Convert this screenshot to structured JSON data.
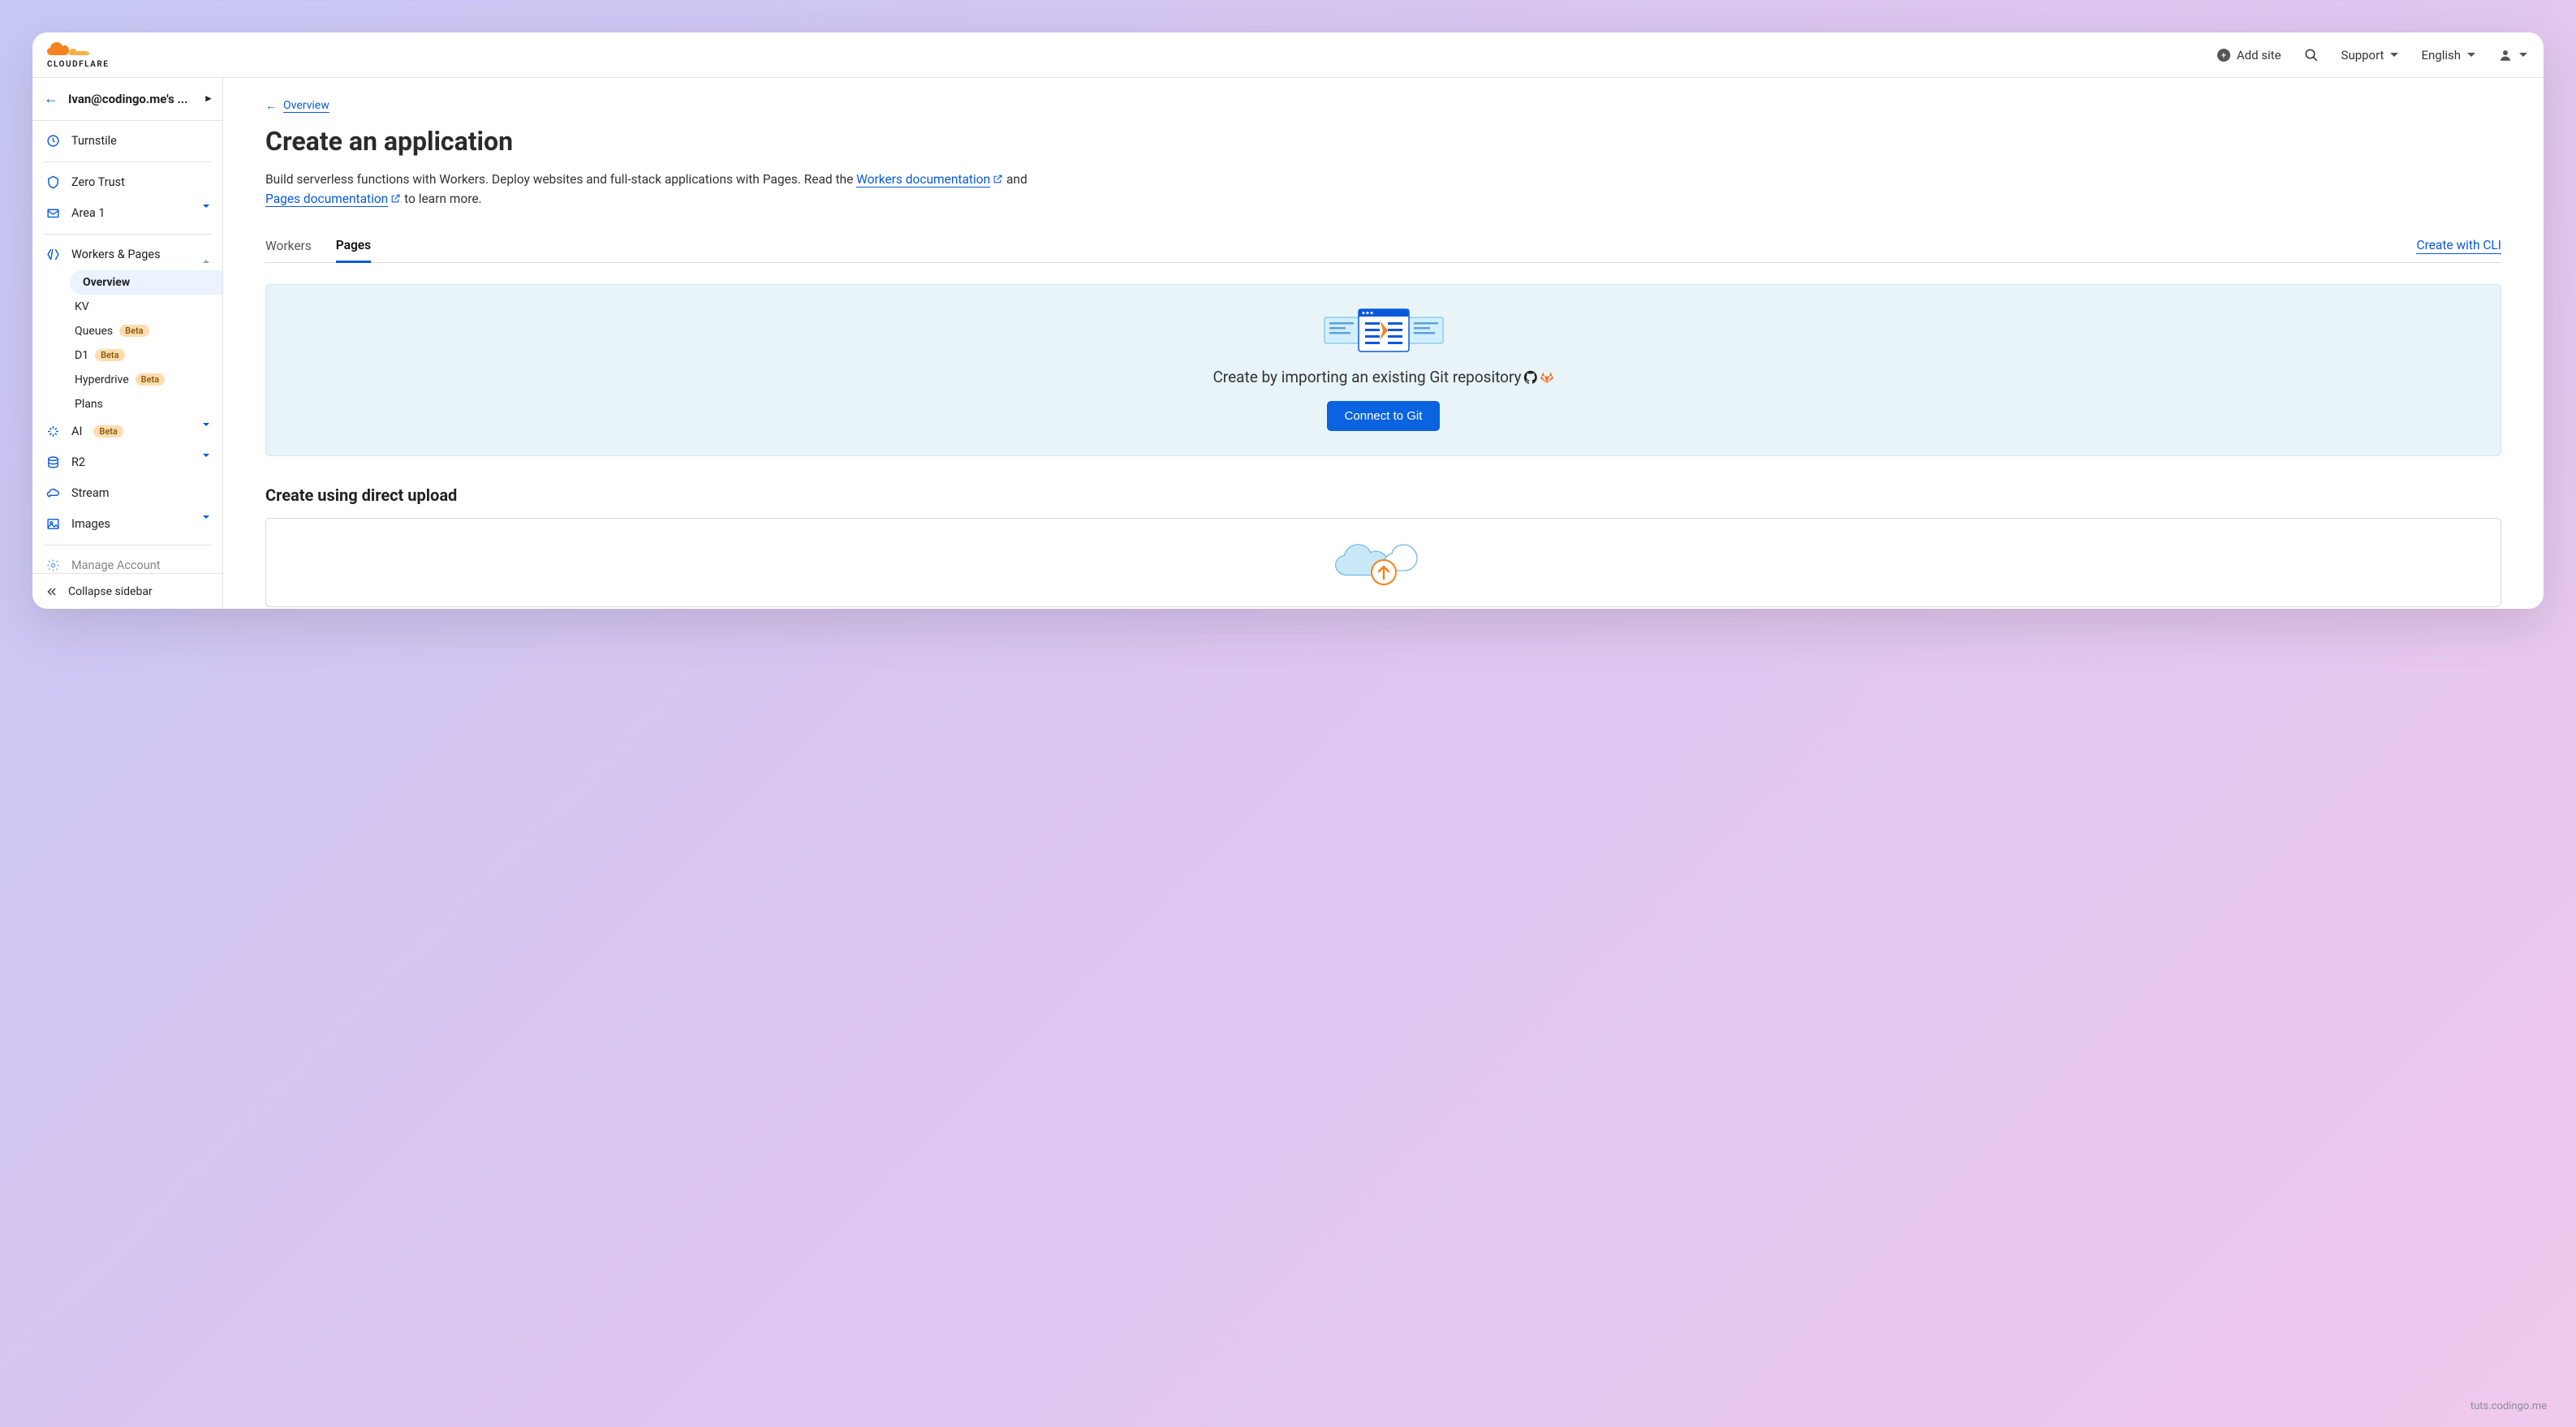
{
  "brand": "CLOUDFLARE",
  "header": {
    "add_site": "Add site",
    "support": "Support",
    "language": "English"
  },
  "account": {
    "name": "Ivan@codingo.me's ..."
  },
  "sidebar": {
    "turnstile": "Turnstile",
    "zero_trust": "Zero Trust",
    "area1": "Area 1",
    "workers_pages": "Workers & Pages",
    "sub": {
      "overview": "Overview",
      "kv": "KV",
      "queues": "Queues",
      "d1": "D1",
      "hyperdrive": "Hyperdrive",
      "plans": "Plans"
    },
    "ai": "AI",
    "r2": "R2",
    "stream": "Stream",
    "images": "Images",
    "manage_account": "Manage Account",
    "beta": "Beta",
    "collapse": "Collapse sidebar"
  },
  "main": {
    "back": "Overview",
    "title": "Create an application",
    "desc_1": "Build serverless functions with Workers. Deploy websites and full-stack applications with Pages. Read the ",
    "desc_link1": "Workers documentation",
    "desc_mid": " and ",
    "desc_link2": "Pages documentation",
    "desc_2": " to learn more.",
    "tabs": {
      "workers": "Workers",
      "pages": "Pages"
    },
    "cli": "Create with CLI",
    "panel": {
      "heading": "Create by importing an existing Git repository",
      "button": "Connect to Git"
    },
    "section2": "Create using direct upload"
  },
  "watermark": "tuts.codingo.me"
}
